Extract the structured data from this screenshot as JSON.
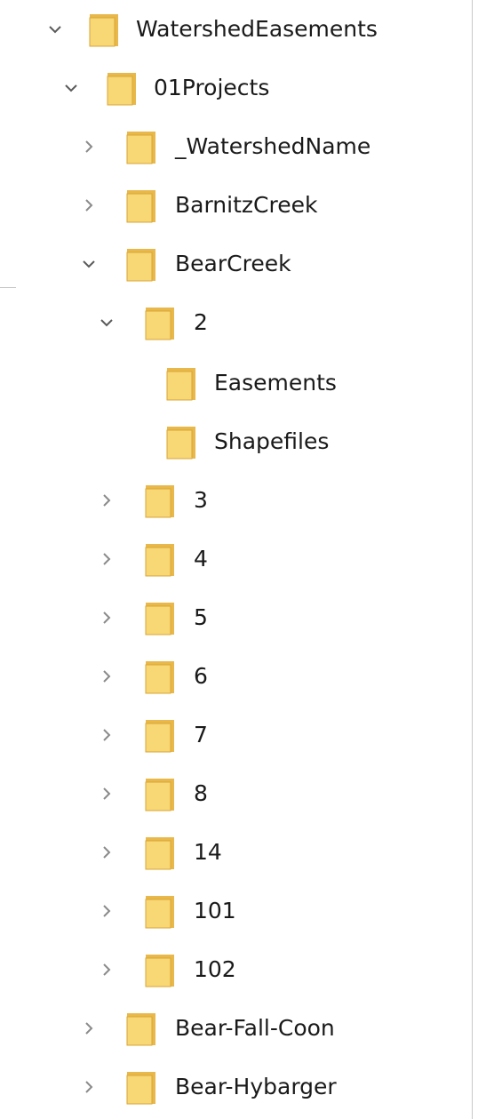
{
  "tree": {
    "items": [
      {
        "label": "WatershedEasements",
        "icon": "folder-icon",
        "state": "expanded"
      },
      {
        "label": "01Projects",
        "icon": "folder-icon",
        "state": "expanded"
      },
      {
        "label": "_WatershedName",
        "icon": "folder-icon",
        "state": "collapsed"
      },
      {
        "label": "BarnitzCreek",
        "icon": "folder-icon",
        "state": "collapsed"
      },
      {
        "label": "BearCreek",
        "icon": "folder-icon",
        "state": "expanded"
      },
      {
        "label": "2",
        "icon": "folder-icon",
        "state": "expanded"
      },
      {
        "label": "Easements",
        "icon": "folder-icon",
        "state": "leaf"
      },
      {
        "label": "Shapefiles",
        "icon": "folder-icon",
        "state": "leaf"
      },
      {
        "label": "3",
        "icon": "folder-icon",
        "state": "collapsed"
      },
      {
        "label": "4",
        "icon": "folder-icon",
        "state": "collapsed"
      },
      {
        "label": "5",
        "icon": "folder-icon",
        "state": "collapsed"
      },
      {
        "label": "6",
        "icon": "folder-icon",
        "state": "collapsed"
      },
      {
        "label": "7",
        "icon": "folder-icon",
        "state": "collapsed"
      },
      {
        "label": "8",
        "icon": "folder-icon",
        "state": "collapsed"
      },
      {
        "label": "14",
        "icon": "folder-icon",
        "state": "collapsed"
      },
      {
        "label": "101",
        "icon": "folder-icon",
        "state": "collapsed"
      },
      {
        "label": "102",
        "icon": "folder-icon",
        "state": "collapsed"
      },
      {
        "label": "Bear-Fall-Coon",
        "icon": "folder-icon",
        "state": "collapsed"
      },
      {
        "label": "Bear-Hybarger",
        "icon": "folder-icon",
        "state": "collapsed"
      }
    ]
  },
  "colors": {
    "folder_body": "#f8d775",
    "folder_back": "#e9b84a",
    "chevron": "#5a5a5a",
    "chevron_collapsed": "#8a8a8a",
    "text": "#1a1a1a"
  }
}
